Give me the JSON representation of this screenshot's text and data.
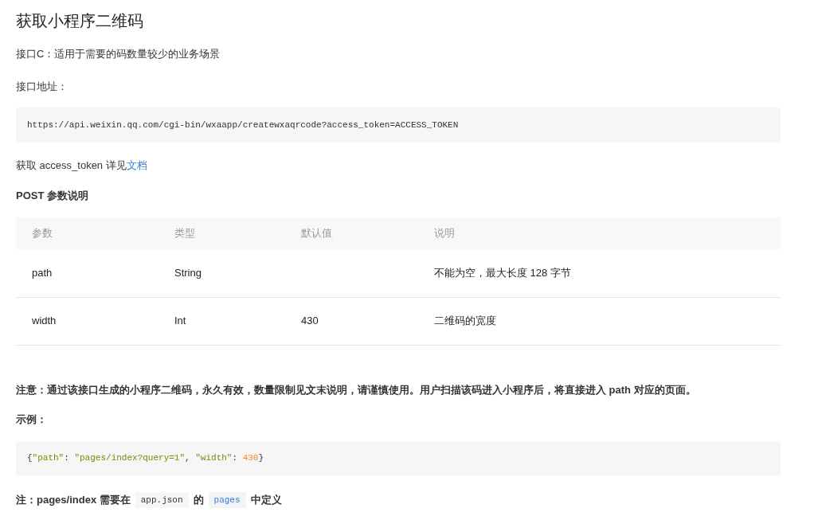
{
  "title": "获取小程序二维码",
  "intro": "接口C：适用于需要的码数量较少的业务场景",
  "address_label": "接口地址：",
  "address_code": "https://api.weixin.qq.com/cgi-bin/wxaapp/createwxaqrcode?access_token=ACCESS_TOKEN",
  "token_note": {
    "text": "获取 access_token 详见",
    "link": "文档"
  },
  "params_heading": "POST 参数说明",
  "table": {
    "columns": [
      "参数",
      "类型",
      "默认值",
      "说明"
    ],
    "rows": [
      [
        "path",
        "String",
        "",
        "不能为空，最大长度 128 字节"
      ],
      [
        "width",
        "Int",
        "430",
        "二维码的宽度"
      ]
    ]
  },
  "notice": "注意：通过该接口生成的小程序二维码，永久有效，数量限制见文末说明，请谨慎使用。用户扫描该码进入小程序后，将直接进入 path 对应的页面。",
  "example_label": "示例：",
  "example_code": [
    {
      "kind": "punct",
      "text": "{"
    },
    {
      "kind": "string",
      "text": "\"path\""
    },
    {
      "kind": "punct",
      "text": ": "
    },
    {
      "kind": "string",
      "text": "\"pages/index?query=1\""
    },
    {
      "kind": "punct",
      "text": ", "
    },
    {
      "kind": "string",
      "text": "\"width\""
    },
    {
      "kind": "punct",
      "text": ": "
    },
    {
      "kind": "number",
      "text": "430"
    },
    {
      "kind": "punct",
      "text": "}"
    }
  ],
  "footnote": [
    {
      "kind": "text",
      "text": "注：pages/index 需要在"
    },
    {
      "kind": "code",
      "text": "app.json"
    },
    {
      "kind": "text",
      "text": "的"
    },
    {
      "kind": "code-link",
      "text": "pages"
    },
    {
      "kind": "text",
      "text": "中定义"
    }
  ]
}
